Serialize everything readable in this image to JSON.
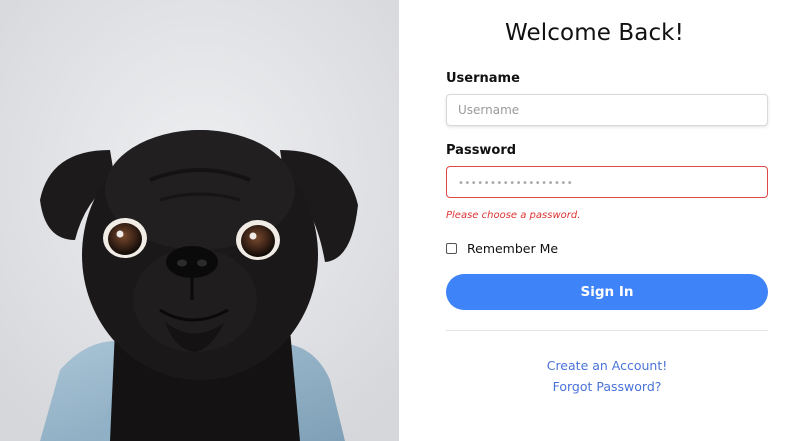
{
  "form": {
    "title": "Welcome Back!",
    "username_label": "Username",
    "username_placeholder": "Username",
    "password_label": "Password",
    "password_placeholder": "••••••••••••••••••",
    "password_error": "Please choose a password.",
    "remember_label": "Remember Me",
    "signin_label": "Sign In",
    "create_account_link": "Create an Account!",
    "forgot_password_link": "Forgot Password?"
  },
  "colors": {
    "primary": "#3f83f8",
    "error": "#e04848",
    "link": "#4a73d9"
  }
}
